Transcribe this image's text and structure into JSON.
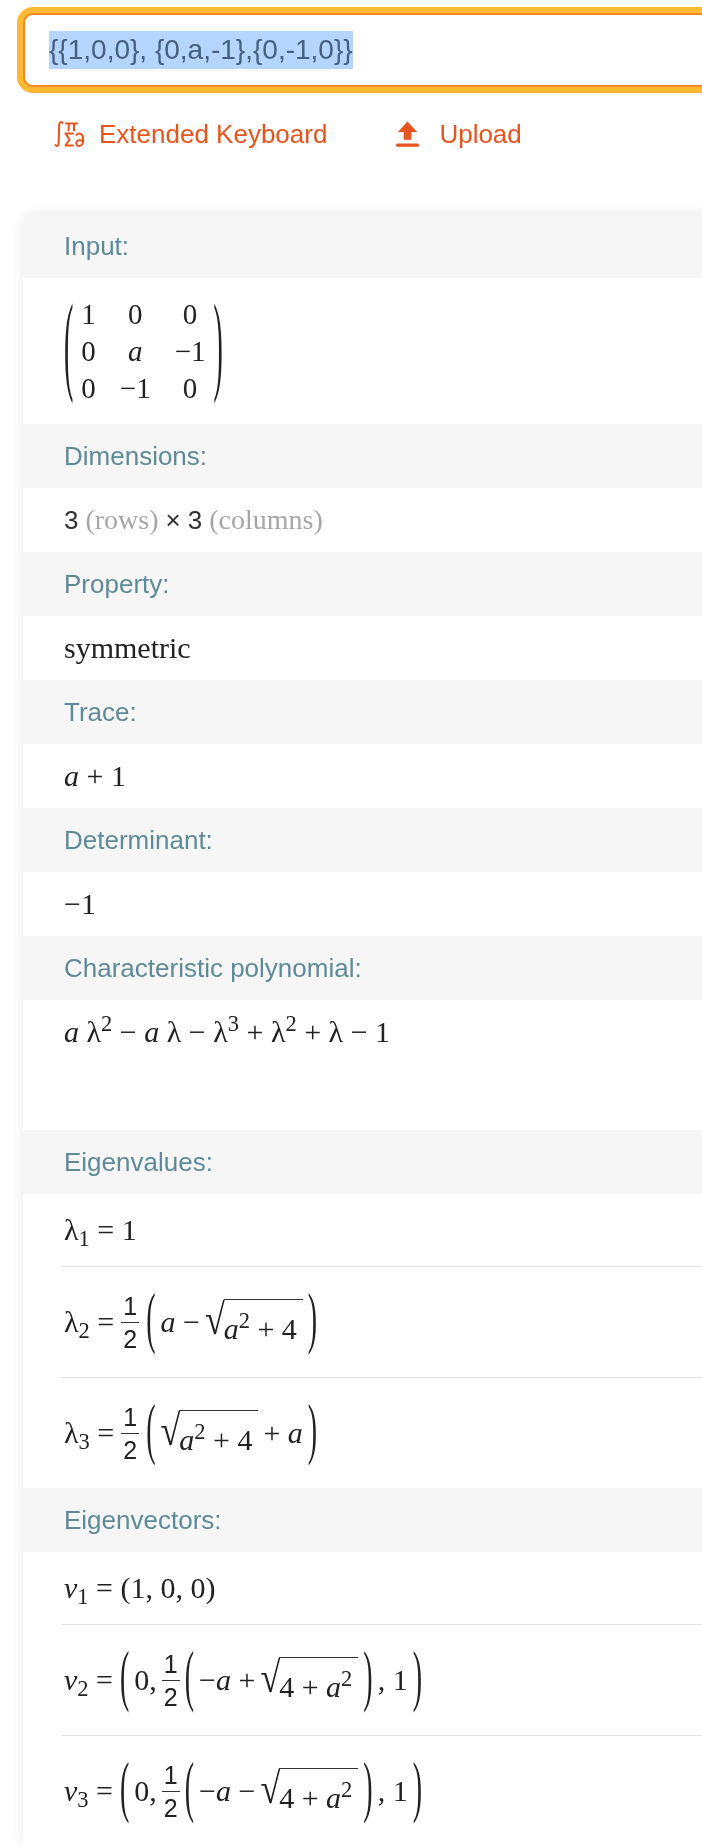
{
  "query": {
    "value": "{{1,0,0}, {0,a,-1},{0,-1,0}}",
    "text_selected": true
  },
  "links": [
    {
      "kind": "keyboard",
      "label": "Extended Keyboard"
    },
    {
      "kind": "upload",
      "label": "Upload"
    }
  ],
  "pods": [
    {
      "title": "Input:",
      "rows": [
        [
          {
            "kind": "matrix",
            "open": "(",
            "close": ")",
            "cells": [
              [
                "1",
                "0",
                "0"
              ],
              [
                "0",
                "*a*",
                "−1"
              ],
              [
                "0",
                "−1",
                "0"
              ]
            ]
          }
        ]
      ]
    },
    {
      "title": "Dimensions:",
      "rows": [
        [
          {
            "kind": "plain",
            "text": "3"
          },
          {
            "kind": "unit",
            "text": "(rows)"
          },
          {
            "kind": "plain",
            "text": "×"
          },
          {
            "kind": "plain",
            "text": "3"
          },
          {
            "kind": "unit",
            "text": "(columns)"
          }
        ]
      ]
    },
    {
      "title": "Property:",
      "rows": [
        [
          {
            "kind": "text",
            "text": "symmetric"
          }
        ]
      ]
    },
    {
      "title": "Trace:",
      "rows": [
        [
          {
            "kind": "text",
            "text": "*a* + 1"
          }
        ]
      ]
    },
    {
      "title": "Determinant:",
      "rows": [
        [
          {
            "kind": "text",
            "text": "−1"
          }
        ]
      ]
    },
    {
      "title": "Characteristic polynomial:",
      "rows": [
        [
          {
            "kind": "text",
            "text": "*a* λ$^{2}$ − *a* λ − λ$^{3}$ + λ$^{2}$ + λ − 1"
          }
        ]
      ]
    },
    {
      "title": "Eigenvalues:",
      "rows": [
        [
          {
            "kind": "text",
            "text": "λ$_{1}$ = 1"
          }
        ],
        [
          {
            "kind": "text",
            "text": "λ$_{2}$ ="
          },
          {
            "kind": "frac",
            "num": "1",
            "den": "2"
          },
          {
            "kind": "group",
            "open": "(",
            "close": ")",
            "body": [
              {
                "kind": "text",
                "text": "*a* −"
              },
              {
                "kind": "sqrt",
                "sign": "√",
                "body": [
                  {
                    "kind": "text",
                    "text": "*a*$^{2}$ + 4"
                  }
                ]
              }
            ]
          }
        ],
        [
          {
            "kind": "text",
            "text": "λ$_{3}$ ="
          },
          {
            "kind": "frac",
            "num": "1",
            "den": "2"
          },
          {
            "kind": "group",
            "open": "(",
            "close": ")",
            "body": [
              {
                "kind": "sqrt",
                "sign": "√",
                "body": [
                  {
                    "kind": "text",
                    "text": "*a*$^{2}$ + 4"
                  }
                ]
              },
              {
                "kind": "text",
                "text": "+ *a*"
              }
            ]
          }
        ]
      ]
    },
    {
      "title": "Eigenvectors:",
      "rows": [
        [
          {
            "kind": "text",
            "text": "*v*$_{1}$ = (1, 0, 0)"
          }
        ],
        [
          {
            "kind": "text",
            "text": "*v*$_{2}$ ="
          },
          {
            "kind": "group",
            "open": "(",
            "close": ")",
            "body": [
              {
                "kind": "text",
                "text": "0,"
              },
              {
                "kind": "frac",
                "num": "1",
                "den": "2"
              },
              {
                "kind": "group",
                "open": "(",
                "close": ")",
                "body": [
                  {
                    "kind": "text",
                    "text": "−*a* +"
                  },
                  {
                    "kind": "sqrt",
                    "sign": "√",
                    "body": [
                      {
                        "kind": "text",
                        "text": "4 + *a*$^{2}$"
                      }
                    ]
                  }
                ]
              },
              {
                "kind": "text",
                "text": ", 1"
              }
            ]
          }
        ],
        [
          {
            "kind": "text",
            "text": "*v*$_{3}$ ="
          },
          {
            "kind": "group",
            "open": "(",
            "close": ")",
            "body": [
              {
                "kind": "text",
                "text": "0,"
              },
              {
                "kind": "frac",
                "num": "1",
                "den": "2"
              },
              {
                "kind": "group",
                "open": "(",
                "close": ")",
                "body": [
                  {
                    "kind": "text",
                    "text": "−*a* −"
                  },
                  {
                    "kind": "sqrt",
                    "sign": "√",
                    "body": [
                      {
                        "kind": "text",
                        "text": "4 + *a*$^{2}$"
                      }
                    ]
                  }
                ]
              },
              {
                "kind": "text",
                "text": ", 1"
              }
            ]
          }
        ]
      ]
    }
  ]
}
